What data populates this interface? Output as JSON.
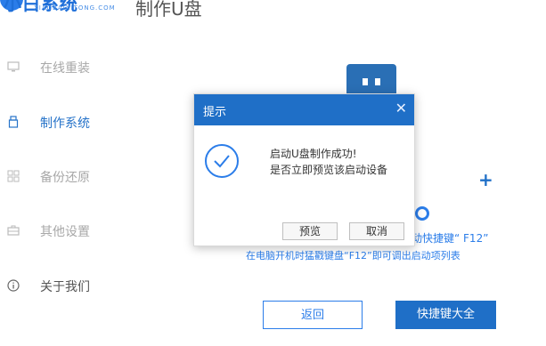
{
  "header": {
    "logo_text": "小白系统",
    "logo_sub": "XIAOBAIXITONG.COM",
    "page_title": "制作U盘"
  },
  "sidebar": {
    "items": [
      {
        "label": "在线重装",
        "icon": "monitor-icon"
      },
      {
        "label": "制作系统",
        "icon": "usb-drive-icon"
      },
      {
        "label": "备份还原",
        "icon": "backup-grid-icon"
      },
      {
        "label": "其他设置",
        "icon": "toolbox-icon"
      },
      {
        "label": "关于我们",
        "icon": "info-icon"
      }
    ],
    "active_index": 1
  },
  "main": {
    "hotkey_hint": "动快捷键“ F12”",
    "boot_hint": "在电脑开机时猛戳键盘“F12”即可调出启动项列表",
    "back_button": "返回",
    "hotkey_button": "快捷键大全"
  },
  "dialog": {
    "title": "提示",
    "close_icon": "close-icon",
    "message_line1": "启动U盘制作成功!",
    "message_line2": "是否立即预览该启动设备",
    "preview_button": "预览",
    "cancel_button": "取消"
  },
  "colors": {
    "accent": "#1f6fc7",
    "sidebar_muted": "#a8a8a8"
  }
}
